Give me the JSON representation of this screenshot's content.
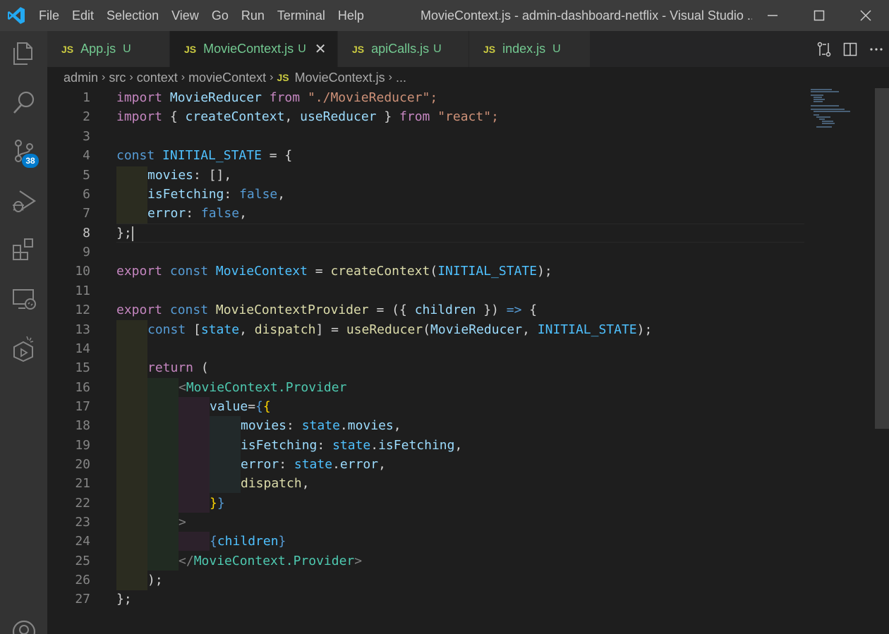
{
  "titlebar": {
    "menu": [
      "File",
      "Edit",
      "Selection",
      "View",
      "Go",
      "Run",
      "Terminal",
      "Help"
    ],
    "title": "MovieContext.js - admin-dashboard-netflix - Visual Studio ...",
    "icons": [
      "vscode-logo-icon",
      "minimize-icon",
      "maximize-icon",
      "close-icon"
    ]
  },
  "activitybar": {
    "items": [
      "explorer-icon",
      "search-icon",
      "source-control-icon",
      "run-debug-icon",
      "extensions-icon",
      "remote-explorer-icon",
      "test-icon",
      "account-icon"
    ],
    "source_control_badge": "38"
  },
  "tabs": [
    {
      "lang": "JS",
      "name": "App.js",
      "status": "U",
      "active": false
    },
    {
      "lang": "JS",
      "name": "MovieContext.js",
      "status": "U",
      "active": true,
      "close": "✕"
    },
    {
      "lang": "JS",
      "name": "apiCalls.js",
      "status": "U",
      "active": false
    },
    {
      "lang": "JS",
      "name": "index.js",
      "status": "U",
      "active": false
    }
  ],
  "breadcrumb": {
    "parts": [
      "admin",
      "src",
      "context",
      "movieContext"
    ],
    "file_lang": "JS",
    "file": "MovieContext.js",
    "tail": "..."
  },
  "editor": {
    "current_line": 8,
    "line_numbers": [
      "1",
      "2",
      "3",
      "4",
      "5",
      "6",
      "7",
      "8",
      "9",
      "10",
      "11",
      "12",
      "13",
      "14",
      "15",
      "16",
      "17",
      "18",
      "19",
      "20",
      "21",
      "22",
      "23",
      "24",
      "25",
      "26",
      "27"
    ],
    "code": {
      "l1": [
        "import",
        " MovieReducer ",
        "from",
        " \"./MovieReducer\";"
      ],
      "l2": [
        "import",
        " { ",
        "createContext",
        ", ",
        "useReducer",
        " } ",
        "from",
        " \"react\";"
      ],
      "l4": [
        "const",
        " ",
        "INITIAL_STATE",
        " = {"
      ],
      "l5": [
        "movies",
        ": [],"
      ],
      "l6": [
        "isFetching",
        ": ",
        "false",
        ","
      ],
      "l7": [
        "error",
        ": ",
        "false",
        ","
      ],
      "l8": [
        "};"
      ],
      "l10": [
        "export",
        " ",
        "const",
        " ",
        "MovieContext",
        " = ",
        "createContext",
        "(",
        "INITIAL_STATE",
        ");"
      ],
      "l12": [
        "export",
        " ",
        "const",
        " ",
        "MovieContextProvider",
        " = (",
        "{",
        " ",
        "children",
        " ",
        "}",
        ") ",
        "=>",
        " {"
      ],
      "l13": [
        "const",
        " [",
        "state",
        ", ",
        "dispatch",
        "] = ",
        "useReducer",
        "(",
        "MovieReducer",
        ", ",
        "INITIAL_STATE",
        ");"
      ],
      "l15": [
        "return",
        " ("
      ],
      "l16": [
        "<",
        "MovieContext.Provider"
      ],
      "l17": [
        "value",
        "=",
        "{",
        "{"
      ],
      "l18": [
        "movies",
        ": ",
        "state",
        ".",
        "movies",
        ","
      ],
      "l19": [
        "isFetching",
        ": ",
        "state",
        ".",
        "isFetching",
        ","
      ],
      "l20": [
        "error",
        ": ",
        "state",
        ".",
        "error",
        ","
      ],
      "l21": [
        "dispatch",
        ","
      ],
      "l22": [
        "}",
        "}"
      ],
      "l23": [
        ">"
      ],
      "l24": [
        "{",
        "children",
        "}"
      ],
      "l25": [
        "</",
        "MovieContext.Provider",
        ">"
      ],
      "l26": [
        ");"
      ],
      "l27": [
        "};"
      ]
    }
  },
  "colors": {
    "background": "#1e1e1e",
    "activitybar": "#333333",
    "titlebar": "#3c3c3c",
    "badge": "#007acc",
    "untracked": "#73c991"
  }
}
